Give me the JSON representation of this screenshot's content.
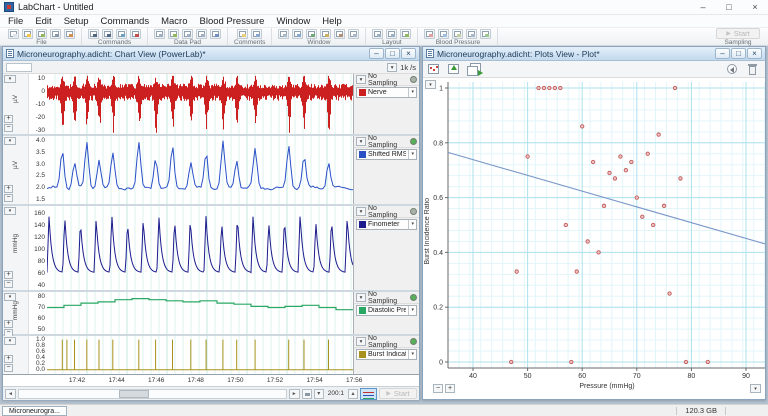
{
  "app": {
    "title": "LabChart - Untitled",
    "window_controls": [
      {
        "name": "minimize-button",
        "glyph": "–"
      },
      {
        "name": "maximize-button",
        "glyph": "□"
      },
      {
        "name": "close-button",
        "glyph": "×"
      }
    ],
    "sampling": {
      "group_label": "Sampling",
      "start_label": "Start",
      "play_glyph": "▶"
    }
  },
  "menu": {
    "items": [
      "File",
      "Edit",
      "Setup",
      "Commands",
      "Macro",
      "Blood Pressure",
      "Window",
      "Help"
    ]
  },
  "toolbar": {
    "groups": [
      {
        "label": "File",
        "icons": [
          {
            "name": "new-file-icon",
            "c": "#dfe5ea"
          },
          {
            "name": "open-file-icon",
            "c": "#f0c850"
          },
          {
            "name": "import-icon",
            "c": "#90b860"
          },
          {
            "name": "print-icon",
            "c": "#8898a8"
          },
          {
            "name": "export-icon",
            "c": "#d09050"
          }
        ]
      },
      {
        "label": "Commands",
        "icons": [
          {
            "name": "find-icon",
            "c": "#506880"
          },
          {
            "name": "select-icon",
            "c": "#506880"
          },
          {
            "name": "marker-icon",
            "c": "#70a0c0"
          },
          {
            "name": "stop-marker-icon",
            "c": "#c05050"
          }
        ]
      },
      {
        "label": "Data Pad",
        "icons": [
          {
            "name": "datapad-view-icon",
            "c": "#a0b0c0"
          },
          {
            "name": "datapad-add-row-icon",
            "c": "#90b860"
          },
          {
            "name": "datapad-select-icon",
            "c": "#a0b0c0"
          },
          {
            "name": "datapad-autosize-icon",
            "c": "#a0b0c0"
          },
          {
            "name": "datapad-window-icon",
            "c": "#7090c0"
          }
        ]
      },
      {
        "label": "Comments",
        "icons": [
          {
            "name": "add-comment-icon",
            "c": "#e8d080"
          },
          {
            "name": "comments-window-icon",
            "c": "#88a8d0"
          }
        ]
      },
      {
        "label": "Window",
        "icons": [
          {
            "name": "tile-windows-icon",
            "c": "#a8b8c8"
          },
          {
            "name": "zoom-view-icon",
            "c": "#88a8d0"
          },
          {
            "name": "spectrum-icon",
            "c": "#70a878"
          },
          {
            "name": "scope-icon",
            "c": "#c8b060"
          },
          {
            "name": "map-icon",
            "c": "#b09078"
          },
          {
            "name": "copy-window-icon",
            "c": "#a8b8c8"
          }
        ]
      },
      {
        "label": "Layout",
        "icons": [
          {
            "name": "layout-grid-icon",
            "c": "#9ab0c4"
          },
          {
            "name": "layout-columns-icon",
            "c": "#9ab0c4"
          },
          {
            "name": "layout-export-icon",
            "c": "#90b860"
          }
        ]
      },
      {
        "label": "Blood Pressure",
        "icons": [
          {
            "name": "bp-start-icon",
            "c": "#e0a0a0"
          },
          {
            "name": "bp-view-icon",
            "c": "#a0c0e0"
          },
          {
            "name": "bp-calc-icon",
            "c": "#c0d0a0"
          },
          {
            "name": "bp-table-icon",
            "c": "#a8b8c8"
          },
          {
            "name": "bp-settings-icon",
            "c": "#98c890"
          }
        ]
      }
    ]
  },
  "chart_window": {
    "title": "Microneurography.adicht: Chart View (PowerLab)*",
    "rate": "1k /s",
    "scroll": {
      "ratio": "200:1",
      "start_label": "Start"
    }
  },
  "plot_window": {
    "title": "Microneurography.adicht: Plots View - Plot*",
    "toolbar_icons": [
      "new-plot-icon",
      "export-plot-icon",
      "duplicate-plot-icon",
      "revert-icon",
      "delete-plot-icon"
    ]
  },
  "status_bar": {
    "tab": "Microneurogra...",
    "disk": "120.3 GB"
  },
  "chart_data": [
    {
      "id": "chart-view-channels",
      "type": "line",
      "x_axis": {
        "ticks": [
          "17:42",
          "17:44",
          "17:46",
          "17:48",
          "17:50",
          "17:52",
          "17:54",
          "17:56"
        ]
      },
      "channels": [
        {
          "name": "Nerve",
          "label": "Nerve",
          "sampling": "No Sampling",
          "color": "#cc1f1f",
          "unit": "µV",
          "ticks": [
            "10",
            "0",
            "-10",
            "-20",
            "-30"
          ],
          "range": [
            13.5,
            -33
          ],
          "signal": "noise-with-bursts",
          "status_color": "#aab2aa",
          "burst_positions": [
            0.05,
            0.09,
            0.13,
            0.17,
            0.215,
            0.3,
            0.355,
            0.41,
            0.47,
            0.52,
            0.575,
            0.62,
            0.68,
            0.79,
            0.84,
            0.92
          ]
        },
        {
          "name": "Shifted RMS Nerve",
          "label": "Shifted RMS N...",
          "sampling": "No Sampling",
          "color": "#2a50c8",
          "unit": "µV",
          "ticks": [
            "4.0",
            "3.5",
            "3.0",
            "2.5",
            "2.0",
            "1.5"
          ],
          "range": [
            4.18,
            1.32
          ],
          "signal": "rms-peaks",
          "status_color": "#58b058",
          "baseline": 2.0,
          "peak_heights": [
            1.6,
            1.1,
            1.9,
            1.2,
            1.4,
            1.9,
            1.3,
            1.7,
            1.1,
            1.5,
            1.9,
            1.2,
            1.6,
            1.8,
            1.3,
            1.1
          ]
        },
        {
          "name": "Finometer",
          "label": "Finometer",
          "sampling": "No Sampling",
          "color": "#1c1c8e",
          "unit": "mmHg",
          "ticks": [
            "160",
            "140",
            "120",
            "100",
            "80",
            "60",
            "40"
          ],
          "range": [
            172,
            32
          ],
          "signal": "arterial-pulses",
          "status_color": "#aab2aa",
          "cycles": 19.5,
          "systolic": 152,
          "diastolic": 61
        },
        {
          "name": "Diastolic Pressure",
          "label": "Diastolic Press...",
          "sampling": "No Sampling",
          "color": "#28a862",
          "unit": "mmHg",
          "ticks": [
            "80",
            "70",
            "60",
            "50"
          ],
          "range": [
            84,
            46
          ],
          "signal": "steps",
          "status_color": "#58b058",
          "steps": [
            70,
            72,
            74,
            75,
            77,
            78,
            77,
            76,
            75,
            76,
            74,
            73,
            71,
            70,
            71,
            72,
            70,
            68
          ]
        },
        {
          "name": "Burst Indicator",
          "label": "Burst Indicator",
          "sampling": "No Sampling",
          "color": "#a8921c",
          "unit": "",
          "ticks": [
            "1.0",
            "0.8",
            "0.6",
            "0.4",
            "0.2",
            "0.0"
          ],
          "range": [
            1.12,
            -0.14
          ],
          "signal": "spikes",
          "status_color": "#58b058",
          "spike_positions": [
            0.05,
            0.065,
            0.09,
            0.13,
            0.17,
            0.215,
            0.3,
            0.355,
            0.41,
            0.47,
            0.52,
            0.575,
            0.62,
            0.68,
            0.79,
            0.84,
            0.92
          ]
        }
      ]
    },
    {
      "id": "plot-view-scatter",
      "type": "scatter",
      "xlabel": "Pressure (mmHg)",
      "ylabel": "Burst Incidence Ratio",
      "xticks": [
        40,
        50,
        60,
        70,
        80,
        90
      ],
      "yticks": [
        0,
        0.2,
        0.4,
        0.6,
        0.8,
        1
      ],
      "xlim": [
        35.4,
        93.5
      ],
      "ylim": [
        -0.02,
        1.03
      ],
      "grid": "minor and major, light cyan",
      "point_color": "#c25a5a",
      "line_color": "#7a96c8",
      "points": [
        [
          52,
          1
        ],
        [
          53,
          1
        ],
        [
          54,
          1
        ],
        [
          55,
          1
        ],
        [
          56,
          1
        ],
        [
          77,
          1
        ],
        [
          60,
          0.86
        ],
        [
          74,
          0.83
        ],
        [
          72,
          0.76
        ],
        [
          50,
          0.75
        ],
        [
          67,
          0.75
        ],
        [
          62,
          0.73
        ],
        [
          69,
          0.73
        ],
        [
          68,
          0.7
        ],
        [
          65,
          0.69
        ],
        [
          66,
          0.67
        ],
        [
          78,
          0.67
        ],
        [
          70,
          0.6
        ],
        [
          64,
          0.57
        ],
        [
          75,
          0.57
        ],
        [
          71,
          0.53
        ],
        [
          57,
          0.5
        ],
        [
          73,
          0.5
        ],
        [
          61,
          0.44
        ],
        [
          63,
          0.4
        ],
        [
          48,
          0.33
        ],
        [
          59,
          0.33
        ],
        [
          76,
          0.25
        ],
        [
          47,
          0
        ],
        [
          58,
          0
        ],
        [
          79,
          0
        ],
        [
          83,
          0
        ]
      ],
      "trendline": {
        "x1": 35.4,
        "y1": 0.765,
        "x2": 93.5,
        "y2": 0.431
      }
    }
  ]
}
